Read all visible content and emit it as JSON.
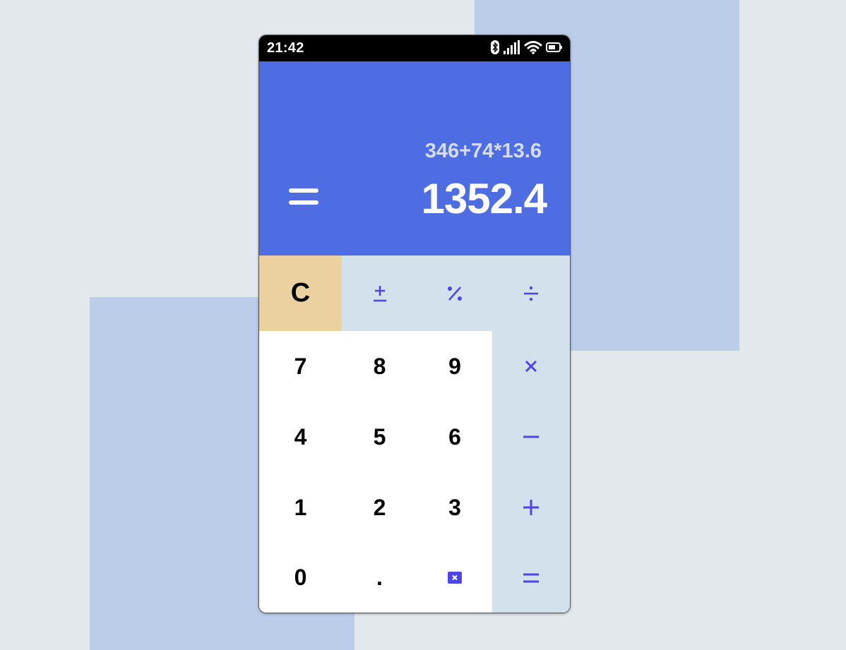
{
  "status_bar": {
    "time": "21:42",
    "icons": [
      "bluetooth-icon",
      "signal-icon",
      "wifi-icon",
      "battery-icon"
    ]
  },
  "display": {
    "expression": "346+74*13.6",
    "result": "1352.4",
    "menu_icon": "menu-icon"
  },
  "keypad": {
    "clear": "C",
    "plus_minus": "±",
    "percent": "%",
    "divide": "÷",
    "seven": "7",
    "eight": "8",
    "nine": "9",
    "multiply": "×",
    "four": "4",
    "five": "5",
    "six": "6",
    "minus": "−",
    "one": "1",
    "two": "2",
    "three": "3",
    "plus": "+",
    "zero": "0",
    "decimal": ".",
    "backspace_icon": "backspace-icon",
    "equals": "="
  },
  "colors": {
    "display_background": "#4e6de2",
    "operator_background": "#d2e1ec",
    "clear_background": "#ebd0a0",
    "accent": "#4d45e6",
    "decor_panels": "#bccde9",
    "page_background": "#e3e8ec"
  }
}
